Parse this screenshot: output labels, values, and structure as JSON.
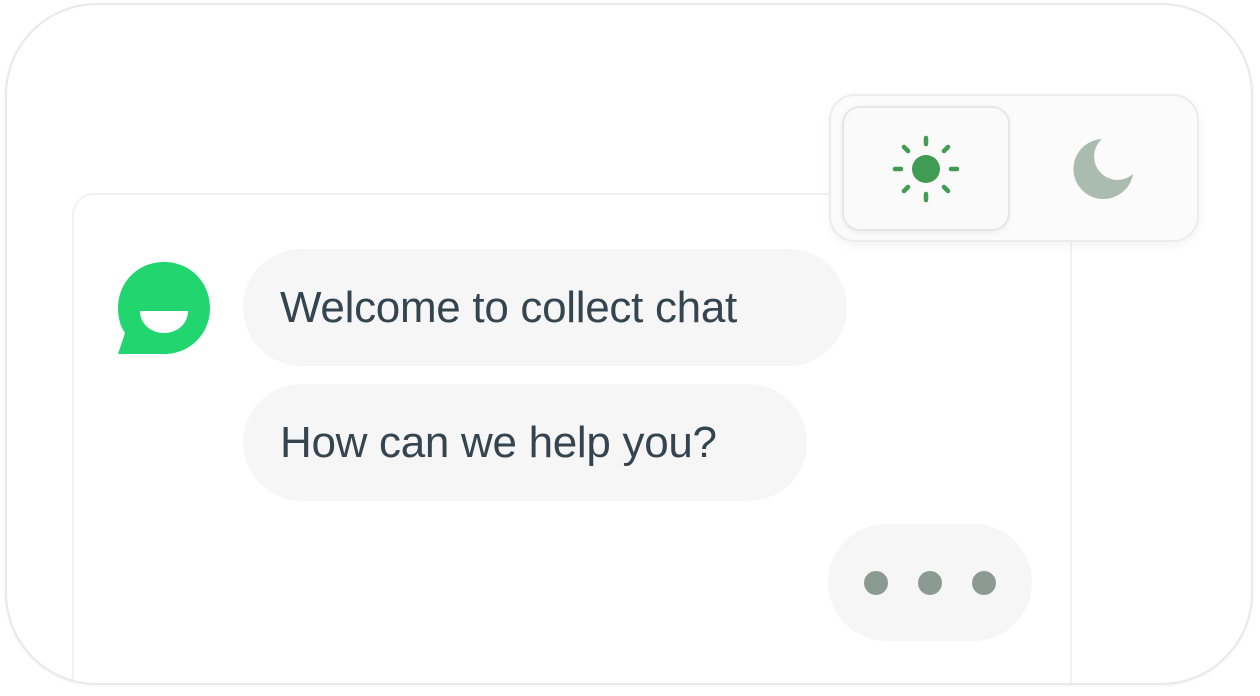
{
  "chat": {
    "messages": [
      {
        "text": "Welcome to collect chat"
      },
      {
        "text": "How can we help you?"
      }
    ],
    "typing_indicator": {
      "dot_count": 3
    }
  },
  "theme_toggle": {
    "options": [
      {
        "icon": "sun-icon",
        "selected": true
      },
      {
        "icon": "moon-icon",
        "selected": false
      }
    ]
  },
  "colors": {
    "brand_green": "#22d66f",
    "sun_active": "#3f9c52",
    "moon_inactive": "#aabbaf",
    "bubble_bg": "#f6f6f6",
    "bubble_text": "#354550",
    "typing_dots": "#8b9a92"
  }
}
